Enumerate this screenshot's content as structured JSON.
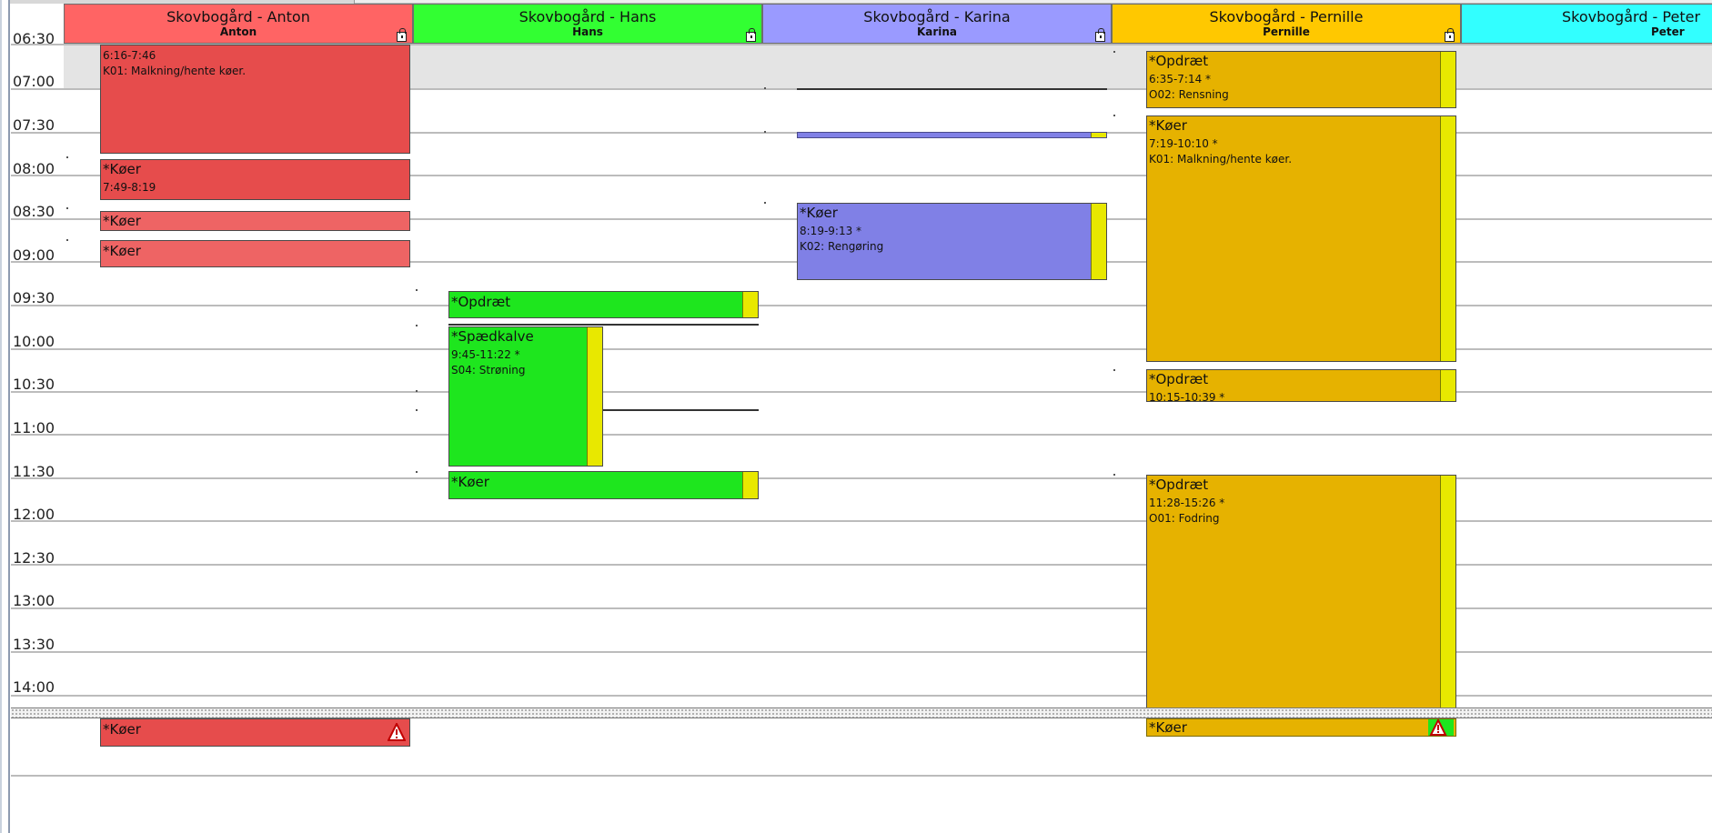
{
  "resources": [
    {
      "title": "Skovbogård - Anton",
      "subtitle": "Anton",
      "color": "#ff6464"
    },
    {
      "title": "Skovbogård - Hans",
      "subtitle": "Hans",
      "color": "#32ff32"
    },
    {
      "title": "Skovbogård - Karina",
      "subtitle": "Karina",
      "color": "#9a9aff"
    },
    {
      "title": "Skovbogård - Pernille",
      "subtitle": "Pernille",
      "color": "#ffc800"
    },
    {
      "title": "Skovbogård - Peter",
      "subtitle": "Peter",
      "color": "#32ffff"
    }
  ],
  "times": [
    "06:30",
    "07:00",
    "07:30",
    "08:00",
    "08:30",
    "09:00",
    "09:30",
    "10:00",
    "10:30",
    "11:00",
    "11:30",
    "12:00",
    "12:30",
    "13:00",
    "13:30",
    "14:00"
  ],
  "events": {
    "anton_1": {
      "time": "6:16-7:46",
      "task": "K01: Malkning/hente køer."
    },
    "anton_2": {
      "title": "*Køer",
      "time": "7:49-8:19"
    },
    "anton_3": {
      "title": "*Køer"
    },
    "anton_4": {
      "title": "*Køer"
    },
    "hans_1": {
      "title": "*Opdræt"
    },
    "hans_2": {
      "title": "*Spædkalve",
      "time": "9:45-11:22 *",
      "task": "S04: Strøning"
    },
    "hans_3": {
      "title": "*Køer"
    },
    "karina_1": {
      "title": "*Køer",
      "time": "8:19-9:13 *",
      "task": "K02: Rengøring"
    },
    "pernille_1": {
      "title": "*Opdræt",
      "time": "6:35-7:14 *",
      "task": "O02: Rensning"
    },
    "pernille_2": {
      "title": "*Køer",
      "time": "7:19-10:10 *",
      "task": "K01: Malkning/hente køer."
    },
    "pernille_3": {
      "title": "*Opdræt",
      "time": "10:15-10:39 *"
    },
    "pernille_4": {
      "title": "*Opdræt",
      "time": "11:28-15:26 *",
      "task": "O01: Fodring"
    }
  },
  "bottom_events": {
    "anton": {
      "title": "*Køer",
      "icon": "warning-icon"
    },
    "pernille": {
      "title": "*Køer",
      "icon": "warning-icon"
    }
  }
}
